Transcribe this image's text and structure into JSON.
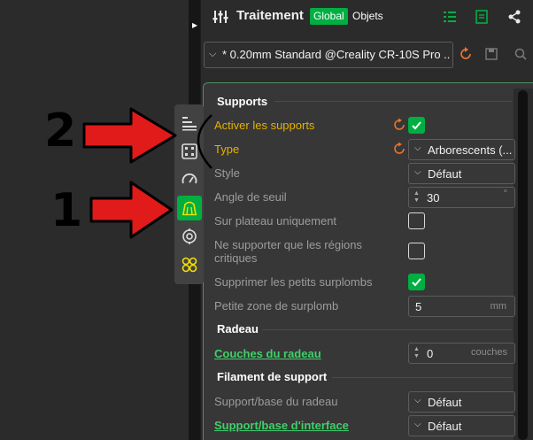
{
  "header": {
    "title": "Traitement",
    "tab_global": "Global",
    "tab_objects": "Objets",
    "icons": [
      "sliders-icon",
      "list-view-icon",
      "notes-icon",
      "share-icon"
    ]
  },
  "preset": {
    "value": "* 0.20mm Standard @Creality CR-10S Pro ...",
    "icons": [
      "reset-icon",
      "save-icon",
      "search-icon"
    ]
  },
  "sections": {
    "supports": "Supports",
    "raft": "Radeau",
    "support_filament": "Filament de support"
  },
  "settings": {
    "enable_supports": {
      "label": "Activer les supports",
      "checked": true
    },
    "type": {
      "label": "Type",
      "value": "Arborescents (..."
    },
    "style": {
      "label": "Style",
      "value": "Défaut"
    },
    "threshold_angle": {
      "label": "Angle de seuil",
      "value": "30",
      "unit": "°"
    },
    "on_build_plate_only": {
      "label": "Sur plateau uniquement",
      "checked": false
    },
    "critical_regions_only": {
      "label_line1": "Ne supporter que les régions",
      "label_line2": "critiques",
      "checked": false
    },
    "remove_small_overhangs": {
      "label": "Supprimer les petits surplombs",
      "checked": true
    },
    "small_overhang_area": {
      "label": "Petite zone de surplomb",
      "value": "5",
      "unit": "mm"
    },
    "raft_layers": {
      "label": "Couches du radeau",
      "value": "0",
      "unit": "couches"
    },
    "raft_base_filament": {
      "label": "Support/base du radeau",
      "value": "Défaut"
    },
    "interface_filament": {
      "label": "Support/base d'interface",
      "value": "Défaut"
    }
  },
  "annotations": {
    "label_2": "2",
    "label_1": "1"
  },
  "colors": {
    "accent_green": "#00ae42",
    "highlight_yellow": "#e6b100",
    "link_green": "#3fd06a",
    "reset_orange": "#e8742c",
    "arrow_red": "#e11a1a"
  }
}
